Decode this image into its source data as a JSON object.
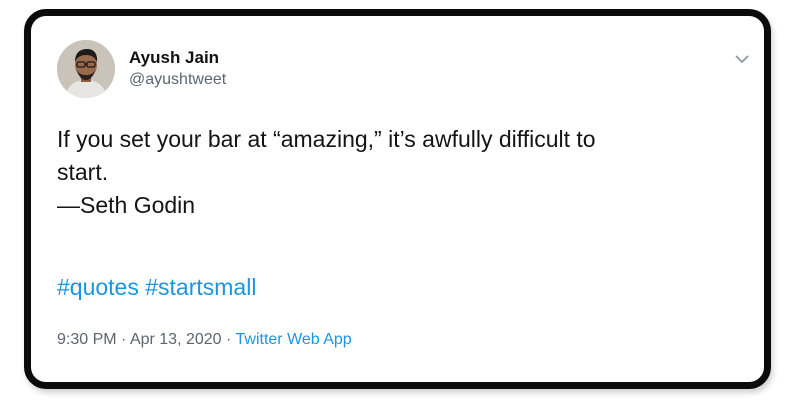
{
  "tweet": {
    "author": {
      "display_name": "Ayush Jain",
      "handle": "@ayushtweet"
    },
    "menu_icon": "chevron-down-icon",
    "text_lines": [
      "If you set your bar at “amazing,” it’s awfully difficult to",
      "start.",
      "—Seth Godin"
    ],
    "hashtags": [
      "#quotes",
      "#startsmall"
    ],
    "time": "9:30 PM",
    "separator": "·",
    "date": "Apr 13, 2020",
    "source": "Twitter Web App"
  },
  "colors": {
    "link": "#1b95e0",
    "text": "#141414",
    "secondary": "#5b6670",
    "frame": "#0b0b0b"
  }
}
